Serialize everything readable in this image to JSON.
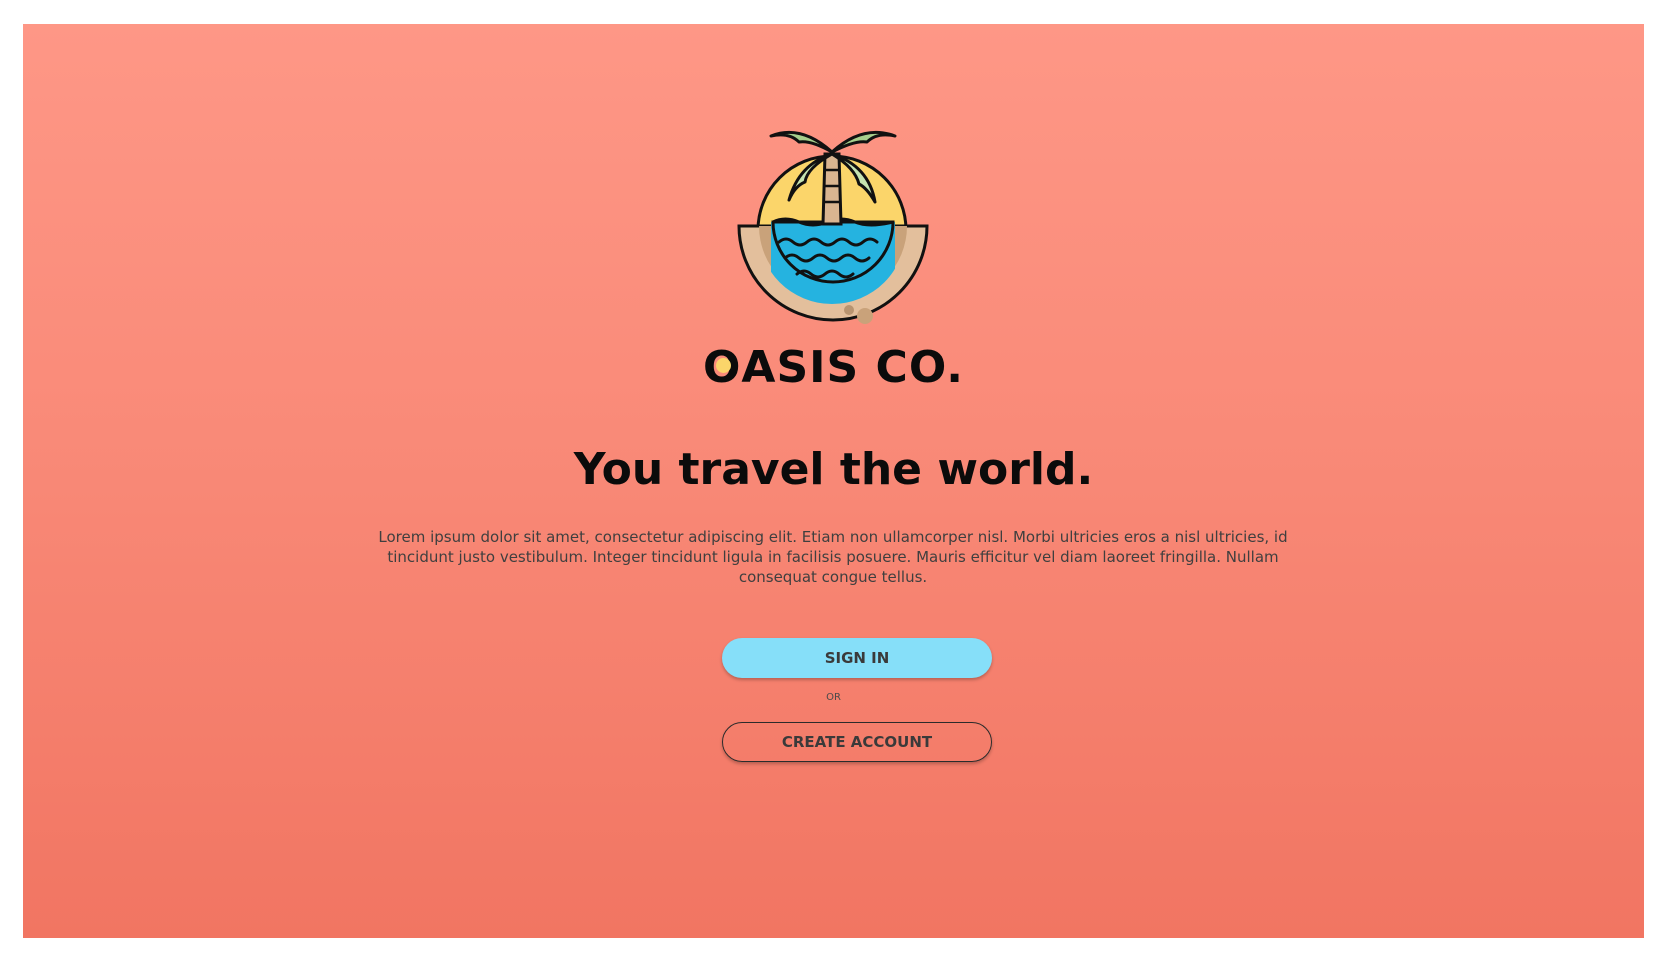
{
  "brand": {
    "name": "OASIS CO.",
    "name_rest": "ASIS CO.",
    "name_first": "O",
    "logo_icon": "palm-island-logo",
    "colors": {
      "background_top": "#fe9786",
      "background_bottom": "#f17562",
      "sun": "#fbd56a",
      "sea": "#25b3e0",
      "sand": "#e3bf9c",
      "leaf": "#a6cf8c"
    }
  },
  "hero": {
    "headline": "You travel the world.",
    "body": "Lorem ipsum dolor sit amet, consectetur adipiscing elit. Etiam non ullamcorper nisl. Morbi ultricies eros a nisl ultricies, id tincidunt justo vestibulum. Integer tincidunt ligula in facilisis posuere. Mauris efficitur vel diam laoreet fringilla. Nullam consequat congue tellus."
  },
  "actions": {
    "sign_in_label": "SIGN IN",
    "separator": "OR",
    "create_account_label": "CREATE ACCOUNT",
    "sign_in_color": "#86dff9"
  }
}
